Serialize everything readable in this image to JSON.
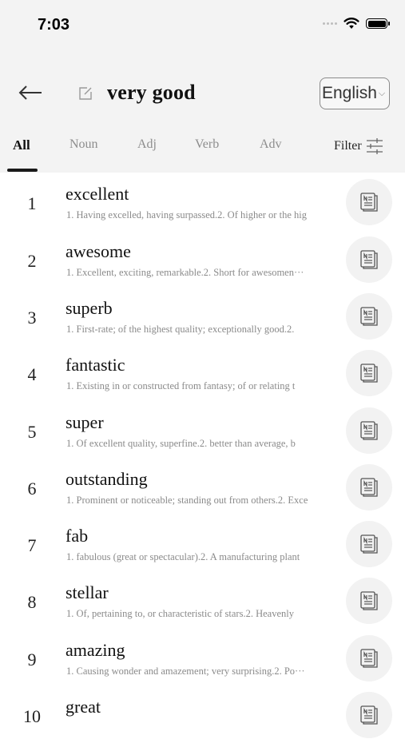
{
  "status_bar": {
    "time": "7:03"
  },
  "header": {
    "query": "very good",
    "language": "English"
  },
  "tabs": [
    {
      "label": "All",
      "active": true
    },
    {
      "label": "Noun",
      "active": false
    },
    {
      "label": "Adj",
      "active": false
    },
    {
      "label": "Verb",
      "active": false
    },
    {
      "label": "Adv",
      "active": false
    }
  ],
  "filter_label": "Filter",
  "results": [
    {
      "rank": "1",
      "word": "excellent",
      "definition": "1. Having excelled, having surpassed.2. Of higher or the hig"
    },
    {
      "rank": "2",
      "word": "awesome",
      "definition": "1. Excellent, exciting, remarkable.2. Short for awesomen···"
    },
    {
      "rank": "3",
      "word": "superb",
      "definition": "1. First-rate; of the highest quality; exceptionally good.2."
    },
    {
      "rank": "4",
      "word": "fantastic",
      "definition": "1. Existing in or constructed from fantasy; of or relating t"
    },
    {
      "rank": "5",
      "word": "super",
      "definition": "1. Of excellent quality, superfine.2. better than average, b"
    },
    {
      "rank": "6",
      "word": "outstanding",
      "definition": "1. Prominent or noticeable; standing out from others.2. Exce"
    },
    {
      "rank": "7",
      "word": "fab",
      "definition": "1. fabulous (great or spectacular).2. A manufacturing plant"
    },
    {
      "rank": "8",
      "word": "stellar",
      "definition": "1. Of, pertaining to, or characteristic of stars.2. Heavenly"
    },
    {
      "rank": "9",
      "word": "amazing",
      "definition": "1. Causing wonder and amazement; very surprising.2. Po···"
    },
    {
      "rank": "10",
      "word": "great",
      "definition": ""
    }
  ]
}
